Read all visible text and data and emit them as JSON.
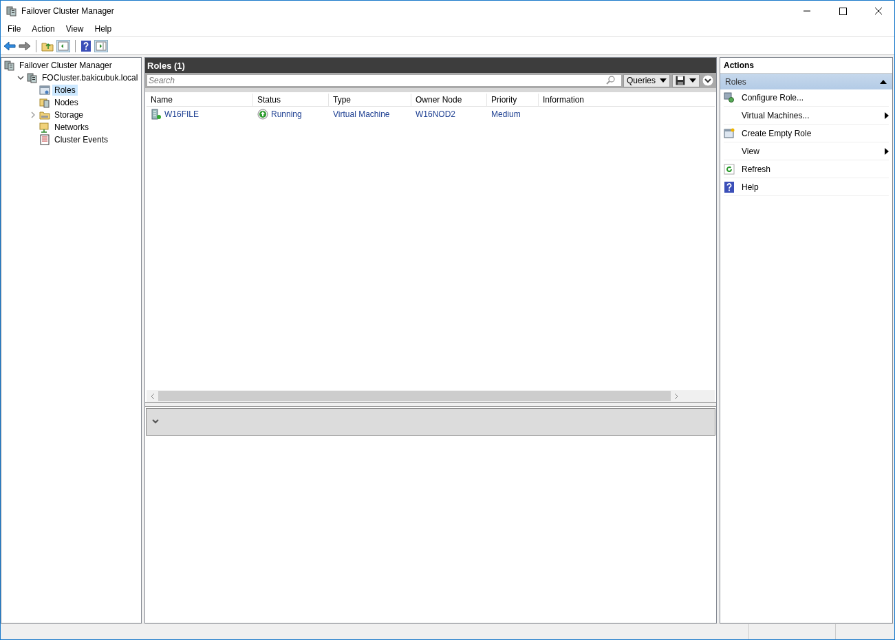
{
  "window": {
    "title": "Failover Cluster Manager"
  },
  "menu": [
    "File",
    "Action",
    "View",
    "Help"
  ],
  "tree": [
    {
      "label": "Failover Cluster Manager",
      "kind": "manager",
      "selected": false,
      "children": [
        {
          "label": "FOCluster.bakicubuk.local",
          "kind": "cluster",
          "selected": false,
          "expanded": true,
          "children": [
            {
              "label": "Roles",
              "kind": "roles",
              "selected": true
            },
            {
              "label": "Nodes",
              "kind": "nodes",
              "selected": false
            },
            {
              "label": "Storage",
              "kind": "storage",
              "selected": false,
              "expanded": false
            },
            {
              "label": "Networks",
              "kind": "networks",
              "selected": false
            },
            {
              "label": "Cluster Events",
              "kind": "events",
              "selected": false
            }
          ]
        }
      ]
    }
  ],
  "center": {
    "title": "Roles (1)",
    "search": {
      "placeholder": "Search"
    },
    "queries_button": "Queries",
    "columns": [
      "Name",
      "Status",
      "Type",
      "Owner Node",
      "Priority",
      "Information"
    ],
    "rows": [
      {
        "name": "W16FILE",
        "status": "Running",
        "type": "Virtual Machine",
        "owner_node": "W16NOD2",
        "priority": "Medium"
      }
    ]
  },
  "actions": {
    "title": "Actions",
    "section": {
      "label": "Roles",
      "expanded": true
    },
    "items": [
      {
        "label": "Configure Role...",
        "kind": "configure",
        "submenu": false
      },
      {
        "label": "Virtual Machines...",
        "kind": "none",
        "submenu": true
      },
      {
        "label": "Create Empty Role",
        "kind": "create",
        "submenu": false
      },
      {
        "label": "View",
        "kind": "none",
        "submenu": true
      },
      {
        "label": "Refresh",
        "kind": "refresh",
        "submenu": false
      },
      {
        "label": "Help",
        "kind": "help",
        "submenu": false
      }
    ]
  }
}
